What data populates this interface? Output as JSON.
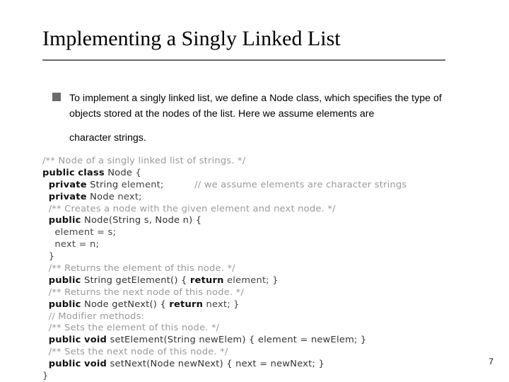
{
  "title": "Implementing a Singly Linked List",
  "bullet": {
    "line1": "To implement a singly linked list, we define a Node class, which specifies the type of objects stored at the nodes of the list. Here we assume elements are",
    "line2": "character strings."
  },
  "code": {
    "c1": "/** Node of a singly linked list of strings. */",
    "kw_public": "public",
    "kw_class": "class",
    "kw_private": "private",
    "kw_void": "void",
    "kw_return": "return",
    "node": "Node",
    "string": "String",
    "open_brace": "{",
    "close_brace": "}",
    "field_element": "element;",
    "cm_elem": "// we assume elements are character strings",
    "field_next": "next;",
    "c_ctor": "/** Creates a node with the given element and next node. */",
    "ctor_sig": "Node(String s, Node n) {",
    "ctor_body1": "element = s;",
    "ctor_body2": "next = n;",
    "c_getel": "/** Returns the element of this node. */",
    "getel": "getElement() {",
    "getel_ret": "element; }",
    "c_getnext": "/** Returns the next node of this node. */",
    "getnext": "getNext() {",
    "getnext_ret": "next; }",
    "cm_mod": "// Modifier methods:",
    "c_setel": "/** Sets the element of this node. */",
    "setel": "setElement(String newElem) { element = newElem; }",
    "c_setnext": "/** Sets the next node of this node. */",
    "setnext": "setNext(Node newNext) { next = newNext; }"
  },
  "page_number": "7"
}
